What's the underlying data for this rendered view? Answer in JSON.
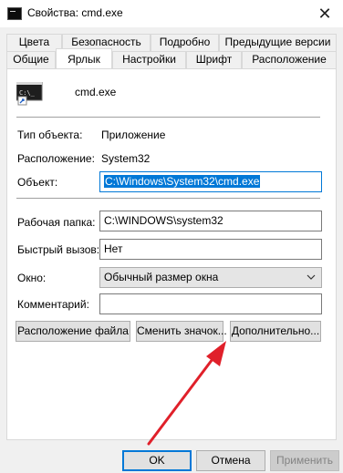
{
  "window": {
    "title": "Свойства: cmd.exe",
    "close_glyph": "✕",
    "icon": "console-app-icon"
  },
  "tabs_row_top": [
    "Цвета",
    "Безопасность",
    "Подробно",
    "Предыдущие версии"
  ],
  "tabs_row_bottom": [
    "Общие",
    "Ярлык",
    "Настройки",
    "Шрифт",
    "Расположение"
  ],
  "active_tab": "Ярлык",
  "shortcut": {
    "file_name": "cmd.exe",
    "icon": "cmd-shortcut-icon",
    "type_label": "Тип объекта:",
    "type_value": "Приложение",
    "location_label": "Расположение:",
    "location_value": "System32",
    "target_label": "Объект:",
    "target_value": "C:\\Windows\\System32\\cmd.exe",
    "start_in_label": "Рабочая папка:",
    "start_in_value": "C:\\WINDOWS\\system32",
    "hotkey_label": "Быстрый вызов:",
    "hotkey_value": "Нет",
    "run_label": "Окно:",
    "run_value": "Обычный размер окна",
    "comment_label": "Комментарий:",
    "comment_value": ""
  },
  "panel_buttons": {
    "open_location": "Расположение файла",
    "change_icon": "Сменить значок...",
    "advanced": "Дополнительно..."
  },
  "dialog_buttons": {
    "ok": "OK",
    "cancel": "Отмена",
    "apply": "Применить"
  },
  "annotation": {
    "arrow_color": "#e0202a"
  },
  "colors": {
    "accent": "#0078d7"
  }
}
